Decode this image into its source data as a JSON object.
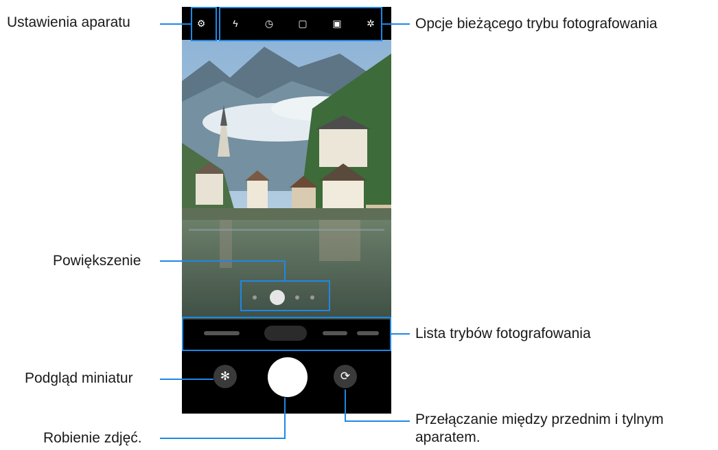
{
  "labels": {
    "camera_settings": "Ustawienia aparatu",
    "current_mode_options": "Opcje bieżącego trybu fotografowania",
    "zoom": "Powiększenie",
    "shooting_modes_list": "Lista trybów fotografowania",
    "thumbnail_preview": "Podgląd miniatur",
    "take_photo": "Robienie zdjęć.",
    "switch_camera_line1": "Przełączanie między przednim i tylnym",
    "switch_camera_line2": "aparatem."
  },
  "icons": {
    "settings": "gear-icon",
    "flash": "flash-icon",
    "timer": "timer-icon",
    "ratio": "aspect-ratio-icon",
    "motion": "motion-photo-icon",
    "effects": "filter-effects-icon",
    "thumbnail": "gallery-thumbnail-icon",
    "switch": "switch-camera-icon"
  },
  "colors": {
    "callout": "#1e88e5",
    "phone_bg": "#000000",
    "shutter": "#ffffff"
  }
}
